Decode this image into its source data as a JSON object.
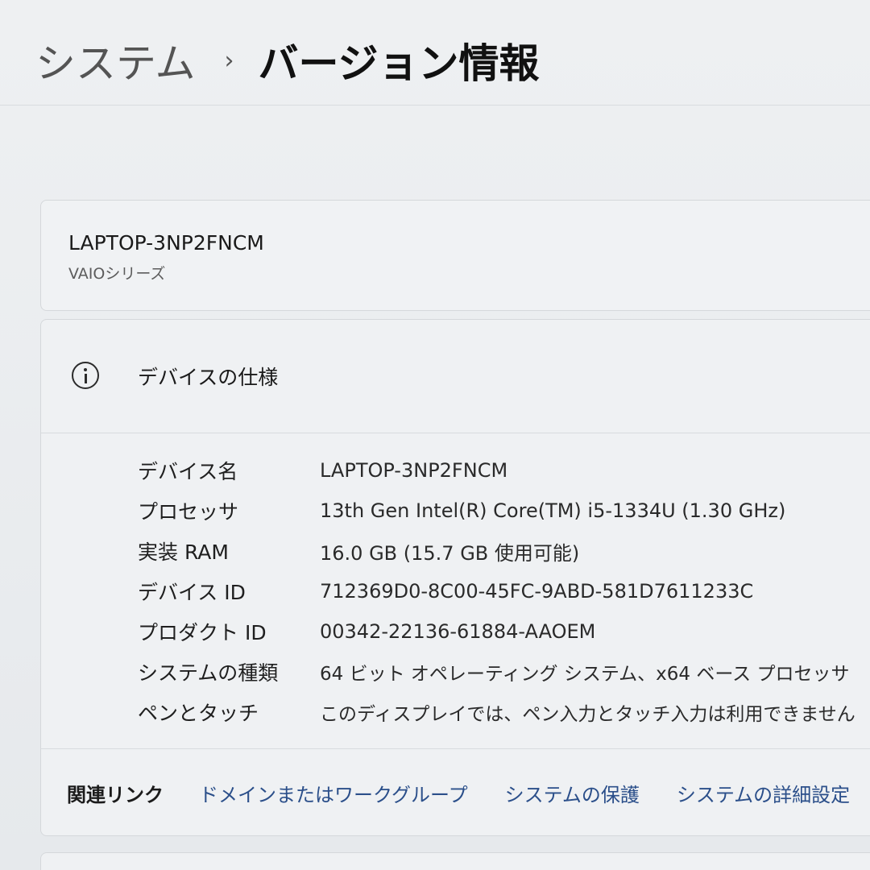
{
  "breadcrumb": {
    "parent": "システム",
    "separator": "›",
    "current": "バージョン情報"
  },
  "device": {
    "name": "LAPTOP-3NP2FNCM",
    "series": "VAIOシリーズ"
  },
  "specs": {
    "icon": "info-icon",
    "title": "デバイスの仕様",
    "rows": [
      {
        "label": "デバイス名",
        "value": "LAPTOP-3NP2FNCM"
      },
      {
        "label": "プロセッサ",
        "value": "13th Gen Intel(R) Core(TM) i5-1334U (1.30 GHz)"
      },
      {
        "label": "実装 RAM",
        "value": "16.0 GB (15.7 GB 使用可能)"
      },
      {
        "label": "デバイス ID",
        "value": "712369D0-8C00-45FC-9ABD-581D7611233C"
      },
      {
        "label": "プロダクト ID",
        "value": "00342-22136-61884-AAOEM"
      },
      {
        "label": "システムの種類",
        "value": "64 ビット オペレーティング システム、x64 ベース プロセッサ"
      },
      {
        "label": "ペンとタッチ",
        "value": "このディスプレイでは、ペン入力とタッチ入力は利用できません"
      }
    ]
  },
  "related_links": {
    "label": "関連リンク",
    "links": [
      "ドメインまたはワークグループ",
      "システムの保護",
      "システムの詳細設定"
    ]
  },
  "colors": {
    "link": "#2b4f8a",
    "background": "#e9ecef"
  }
}
